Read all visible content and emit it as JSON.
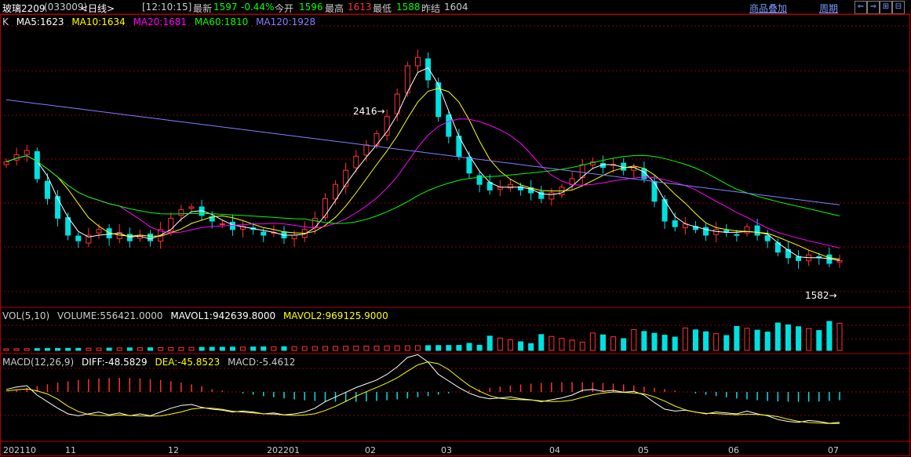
{
  "header": {
    "symbol": "玻璃2209",
    "code": "(033009)",
    "period": "<日线>",
    "time": "[12:10:15]",
    "latest_label": "最新",
    "latest": "1597",
    "change": "-0.44%",
    "open_label": "今开",
    "open": "1596",
    "high_label": "最高",
    "high": "1613",
    "low_label": "最低",
    "low": "1588",
    "prev_close_label": "昨结",
    "prev_close": "1604",
    "overlay_link": "商品叠加",
    "cycle_link": "周期",
    "nav_buttons": [
      "⇐",
      "⇒",
      "⊞",
      "⊟"
    ]
  },
  "colors": {
    "up": "#ff3232",
    "down": "#00e0e0",
    "ma5": "#ffffff",
    "ma10": "#ffff00",
    "ma20": "#ff00ff",
    "ma60": "#00ff00",
    "ma120": "#8080ff",
    "grid": "#8b0000",
    "border": "#b20000"
  },
  "kline": {
    "k_label": "K",
    "ma5": "MA5:1623",
    "ma10": "MA10:1634",
    "ma20": "MA20:1681",
    "ma60": "MA60:1810",
    "ma120": "MA120:1928",
    "high_marker": "2416→",
    "low_marker": "1582→"
  },
  "volume": {
    "label": "VOL(5,10)",
    "volume": "VOLUME:556421.0000",
    "mavol1": "MAVOL1:942639.8000",
    "mavol2": "MAVOL2:969125.9000"
  },
  "macd": {
    "label": "MACD(12,26,9)",
    "diff": "DIFF:-48.5829",
    "dea": "DEA:-45.8523",
    "macd": "MACD:-5.4612"
  },
  "dates": [
    "202110",
    "11",
    "12",
    "202201",
    "02",
    "03",
    "04",
    "05",
    "06",
    "07"
  ],
  "chart_data": {
    "type": "candlestick",
    "price_range": [
      1582,
      2416
    ],
    "close_path": [
      1960,
      1985,
      2000,
      1900,
      1830,
      1760,
      1700,
      1680,
      1700,
      1720,
      1690,
      1710,
      1680,
      1700,
      1680,
      1720,
      1760,
      1790,
      1800,
      1770,
      1750,
      1740,
      1720,
      1730,
      1720,
      1700,
      1710,
      1690,
      1700,
      1720,
      1760,
      1830,
      1880,
      1930,
      1980,
      2020,
      2060,
      2120,
      2200,
      2300,
      2330,
      2250,
      2120,
      2050,
      1980,
      1920,
      1880,
      1860,
      1870,
      1880,
      1860,
      1850,
      1830,
      1850,
      1870,
      1900,
      1950,
      1960,
      1940,
      1950,
      1930,
      1940,
      1900,
      1820,
      1750,
      1730,
      1740,
      1720,
      1700,
      1720,
      1710,
      1700,
      1730,
      1700,
      1680,
      1640,
      1620,
      1610,
      1630,
      1620,
      1600,
      1610
    ]
  }
}
